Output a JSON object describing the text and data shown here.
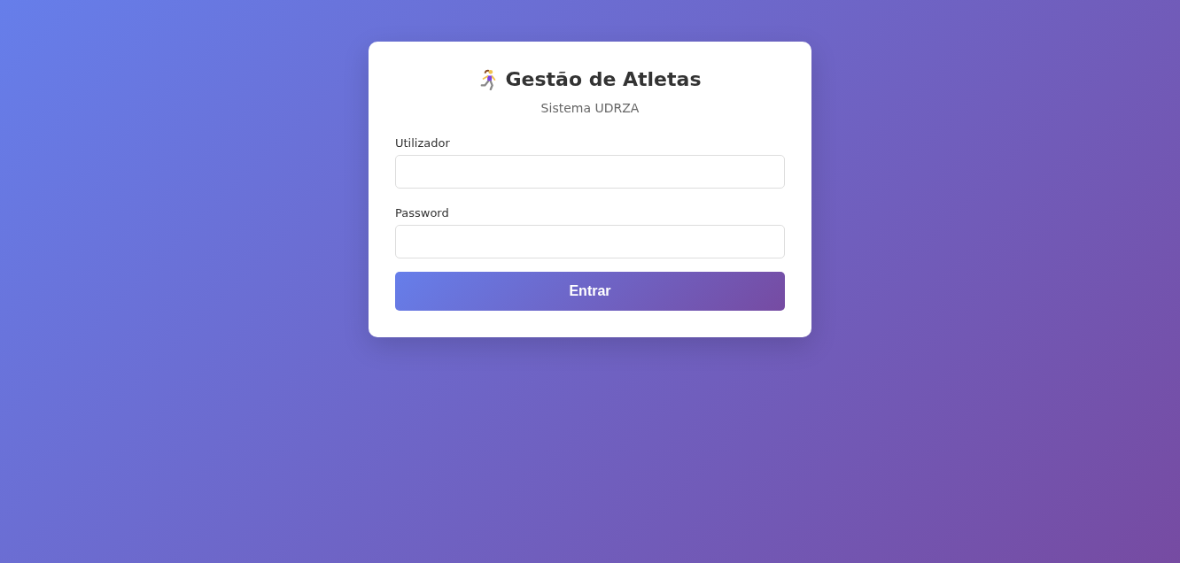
{
  "card": {
    "title": "Gestão de Atletas",
    "subtitle": "Sistema UDRZA"
  },
  "fields": [
    {
      "label": "Utilizador"
    },
    {
      "label": "Password"
    }
  ],
  "submit_button": "Entrar"
}
